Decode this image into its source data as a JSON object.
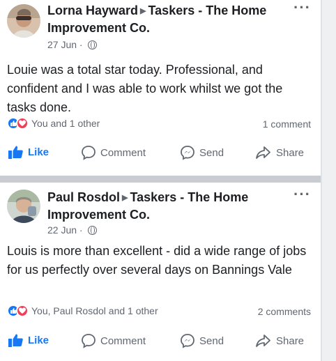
{
  "colors": {
    "accent": "#1877f2",
    "love": "#f33e58",
    "secondary_text": "#606770",
    "divider": "#c9ccd1"
  },
  "posts": [
    {
      "author": "Lorna Hayward",
      "group": "Taskers - The Home Improvement Co.",
      "date": "27 Jun",
      "body": "Louie was a total star today. Professional, and confident and I was able to work whilst we got the tasks done.",
      "reactions_text": "You and 1 other",
      "comments_text": "1 comment",
      "actions": {
        "like": "Like",
        "comment": "Comment",
        "send": "Send",
        "share": "Share"
      }
    },
    {
      "author": "Paul Rosdol",
      "group": "Taskers - The Home Improvement Co.",
      "date": "22 Jun",
      "body": "Louis is more than excellent -  did a wide range of jobs for us perfectly over several days on Bannings Vale",
      "reactions_text": "You, Paul Rosdol and 1 other",
      "comments_text": "2 comments",
      "actions": {
        "like": "Like",
        "comment": "Comment",
        "send": "Send",
        "share": "Share"
      }
    }
  ],
  "icons": {
    "privacy": "globe-icon",
    "more": "more-options-icon",
    "reaction_like": "thumbs-up-icon",
    "reaction_love": "heart-icon",
    "like": "thumbs-up-icon",
    "comment": "speech-bubble-icon",
    "send": "messenger-icon",
    "share": "share-arrow-icon"
  }
}
